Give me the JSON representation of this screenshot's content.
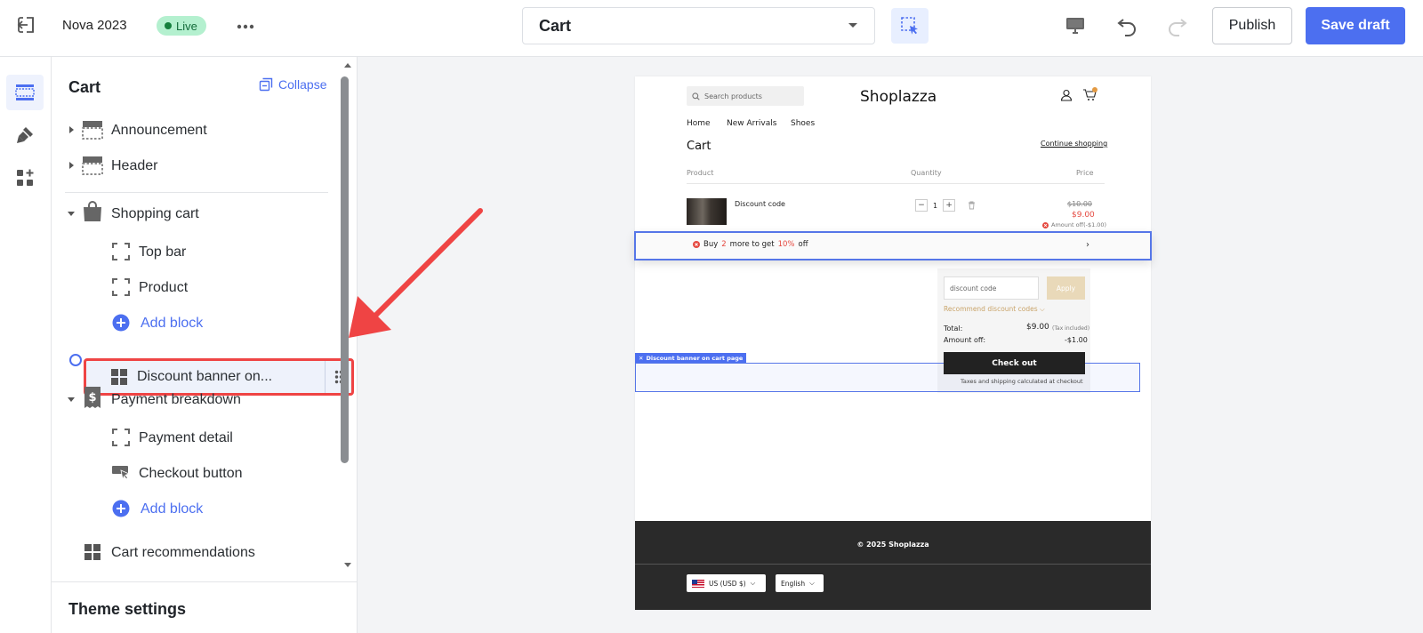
{
  "topbar": {
    "store_name": "Nova 2023",
    "status": "Live",
    "page_selector": "Cart",
    "publish_label": "Publish",
    "save_label": "Save draft"
  },
  "sidebar": {
    "title": "Cart",
    "collapse_label": "Collapse",
    "sections": {
      "announcement": "Announcement",
      "header": "Header",
      "shopping_cart": "Shopping cart",
      "top_bar": "Top bar",
      "product": "Product",
      "add_block_1": "Add block",
      "dragging": "Discount banner on...",
      "payment_breakdown": "Payment breakdown",
      "payment_detail": "Payment detail",
      "checkout_button": "Checkout button",
      "add_block_2": "Add block",
      "cart_recommendations": "Cart recommendations"
    },
    "theme_settings": "Theme settings"
  },
  "preview": {
    "search_placeholder": "Search products",
    "brand": "Shoplazza",
    "nav": [
      "Home",
      "New Arrivals",
      "Shoes"
    ],
    "cart_title": "Cart",
    "continue_shopping": "Continue shopping",
    "columns": {
      "product": "Product",
      "quantity": "Quantity",
      "price": "Price"
    },
    "item": {
      "name": "Discount code",
      "quantity": "1",
      "price_old": "$10.00",
      "price_new": "$9.00",
      "amount_off": "Amount off(-$1.00)"
    },
    "banner": {
      "prefix": "Buy",
      "count": "2",
      "middle": "more to get",
      "percent": "10%",
      "suffix": "off"
    },
    "discount_placeholder": "discount code",
    "apply_label": "Apply",
    "recommend_label": "Recommend discount codes",
    "total_label": "Total:",
    "total_value": "$9.00",
    "tax_note": "(Tax included)",
    "amount_label": "Amount off:",
    "amount_value": "-$1.00",
    "checkout_label": "Check out",
    "taxes_note": "Taxes and shipping calculated at checkout",
    "block_tag": "Discount banner on cart page",
    "copyright": "© 2025 Shoplazza",
    "currency": "US (USD $)",
    "language": "English"
  },
  "colors": {
    "accent": "#4c6ff0",
    "live_bg": "#b4f0cf",
    "highlight": "#ef4444",
    "sale": "#e5483f"
  }
}
